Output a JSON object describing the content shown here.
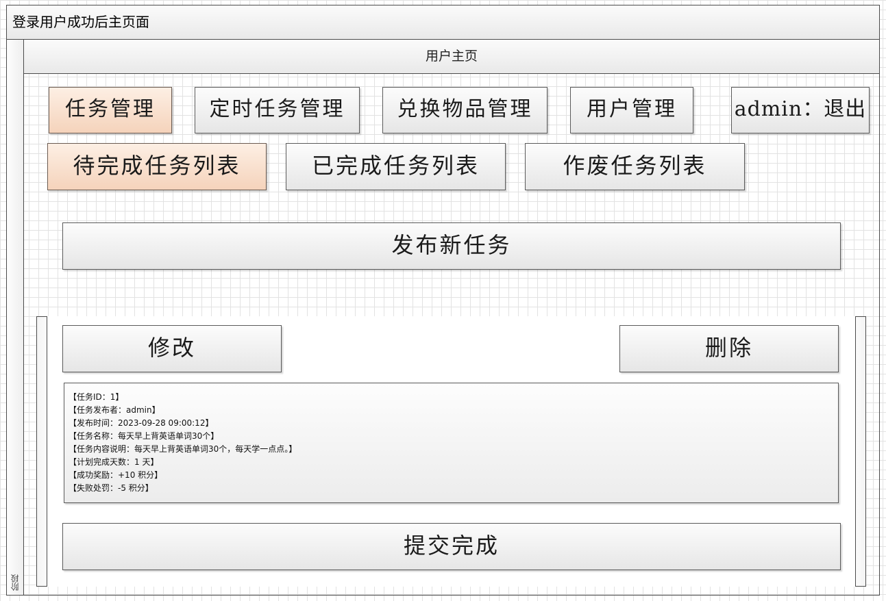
{
  "pool": {
    "title": "登录用户成功后主页面",
    "lane_label": "阶段"
  },
  "page": {
    "title": "用户主页"
  },
  "nav": {
    "task_mgmt": "任务管理",
    "scheduled_task_mgmt": "定时任务管理",
    "exchange_items_mgmt": "兑换物品管理",
    "user_mgmt": "用户管理",
    "logout": "admin：退出"
  },
  "tabs": {
    "pending": "待完成任务列表",
    "completed": "已完成任务列表",
    "voided": "作废任务列表"
  },
  "actions": {
    "publish": "发布新任务"
  },
  "task_card": {
    "edit": "修改",
    "delete": "删除",
    "submit": "提交完成",
    "details": [
      "【任务ID：1】",
      "【任务发布者：admin】",
      "【发布时间：2023-09-28 09:00:12】",
      "【任务名称：每天早上背英语单词30个】",
      "【任务内容说明：每天早上背英语单词30个，每天学一点点。】",
      "【计划完成天数：1 天】",
      "【成功奖励：+10 积分】",
      "【失败处罚：-5 积分】"
    ]
  },
  "colors": {
    "active_button_top": "#fdefe4",
    "active_button_bottom": "#f5d3bb",
    "button_top": "#fcfcfc",
    "button_bottom": "#e6e6e6",
    "grid": "#e2e2e2"
  }
}
